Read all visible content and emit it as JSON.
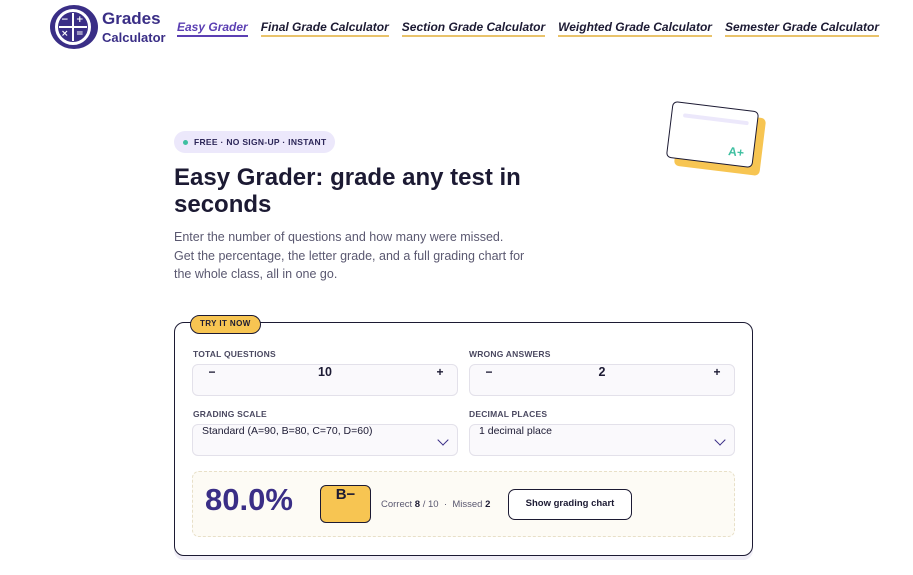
{
  "brand": {
    "logo_line1": "Grades",
    "logo_line2": "Calculator",
    "accent": "#3a2e86",
    "highlight": "#f7c552"
  },
  "nav": {
    "items": [
      {
        "label": "Easy Grader",
        "active": true
      },
      {
        "label": "Final Grade Calculator",
        "active": false
      },
      {
        "label": "Section Grade Calculator",
        "active": false
      },
      {
        "label": "Weighted Grade Calculator",
        "active": false
      },
      {
        "label": "Semester Grade Calculator",
        "active": false
      }
    ]
  },
  "hero": {
    "badge": "FREE · NO SIGN-UP · INSTANT",
    "title": "Easy Grader: grade any test in seconds",
    "intro": "Enter the number of questions and how many were missed. Get the percentage, the letter grade, and a full grading chart for the whole class, all in one go."
  },
  "decoration": {
    "icon": "report-card-icon",
    "grade": "A+"
  },
  "calculator": {
    "tag": "TRY IT NOW",
    "total_questions": {
      "label": "TOTAL QUESTIONS",
      "value": "10",
      "minus": "−",
      "plus": "+"
    },
    "wrong_answers": {
      "label": "WRONG ANSWERS",
      "value": "2",
      "minus": "−",
      "plus": "+"
    },
    "grading_scale": {
      "label": "GRADING SCALE",
      "selected": "Standard (A=90, B=80, C=70, D=60)"
    },
    "decimal_places": {
      "label": "DECIMAL PLACES",
      "selected": "1 decimal place"
    },
    "result": {
      "percentage": "80.0%",
      "letter": "B−",
      "correct_label": "Correct",
      "correct": "8",
      "total": "/ 10",
      "separator": "·",
      "missed_label": "Missed",
      "missed": "2",
      "button": "Show grading chart"
    }
  }
}
